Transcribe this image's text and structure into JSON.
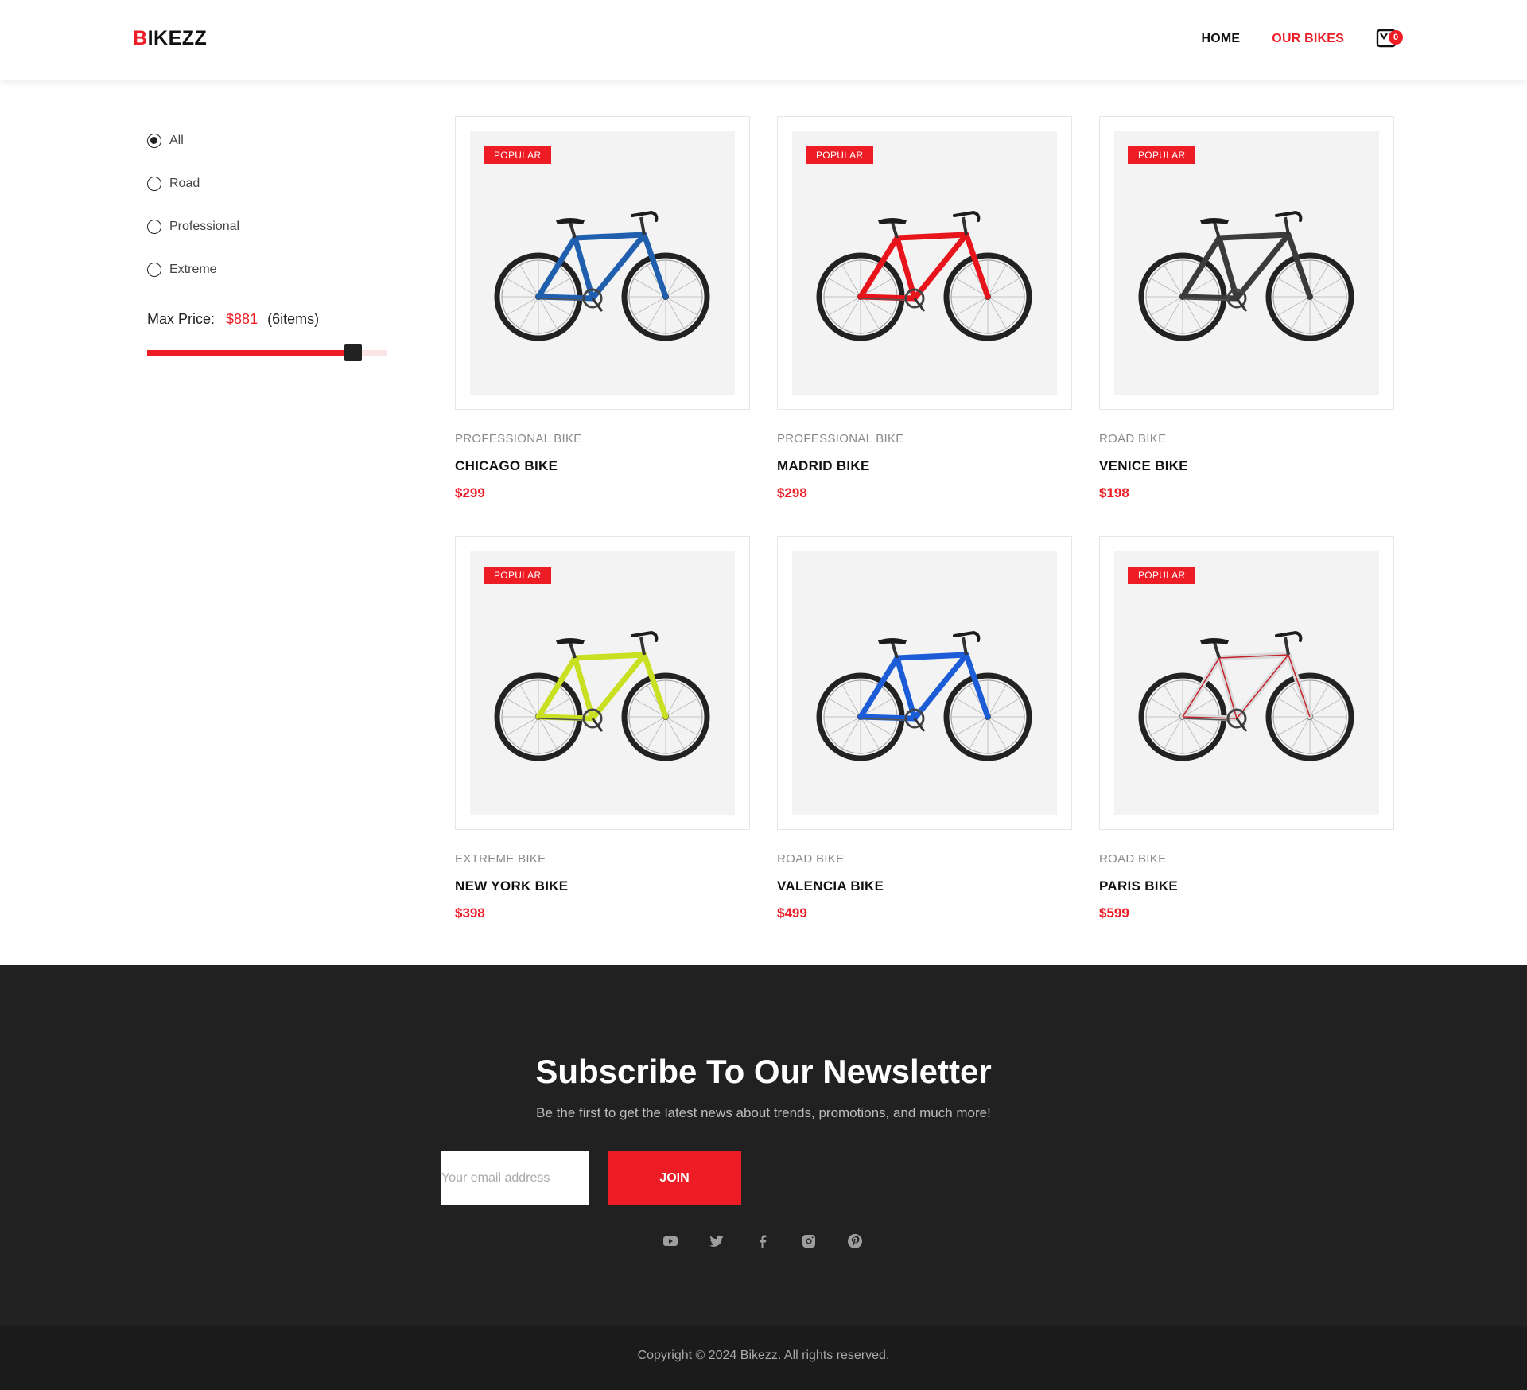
{
  "header": {
    "logo_accent": "B",
    "logo_rest": "IKEZZ",
    "nav": [
      {
        "label": "HOME",
        "active": false
      },
      {
        "label": "OUR BIKES",
        "active": true
      }
    ],
    "cart_count": "0"
  },
  "filters": {
    "options": [
      {
        "label": "All",
        "checked": true
      },
      {
        "label": "Road",
        "checked": false
      },
      {
        "label": "Professional",
        "checked": false
      },
      {
        "label": "Extreme",
        "checked": false
      }
    ],
    "max_price_label": "Max Price:",
    "max_price_value": "$881",
    "item_count": "(6items)",
    "slider_fraction": 0.86
  },
  "products": [
    {
      "badge": "POPULAR",
      "category": "PROFESSIONAL BIKE",
      "name": "CHICAGO BIKE",
      "price": "$299",
      "frame_color": "#1f5fae"
    },
    {
      "badge": "POPULAR",
      "category": "PROFESSIONAL BIKE",
      "name": "MADRID BIKE",
      "price": "$298",
      "frame_color": "#e8141c"
    },
    {
      "badge": "POPULAR",
      "category": "ROAD BIKE",
      "name": "VENICE BIKE",
      "price": "$198",
      "frame_color": "#3b3b3b"
    },
    {
      "badge": "POPULAR",
      "category": "EXTREME BIKE",
      "name": "NEW YORK BIKE",
      "price": "$398",
      "frame_color": "#c8e021"
    },
    {
      "badge": "",
      "category": "ROAD BIKE",
      "name": "VALENCIA BIKE",
      "price": "$499",
      "frame_color": "#1c5cd6"
    },
    {
      "badge": "POPULAR",
      "category": "ROAD BIKE",
      "name": "PARIS BIKE",
      "price": "$599",
      "frame_color": "#d9d9d9"
    }
  ],
  "newsletter": {
    "title": "Subscribe To Our Newsletter",
    "subtitle": "Be the first to get the latest news about trends, promotions, and much more!",
    "email_placeholder": "Your email address",
    "join_label": "JOIN",
    "social_icons": [
      "youtube-icon",
      "twitter-icon",
      "facebook-icon",
      "instagram-icon",
      "pinterest-icon"
    ]
  },
  "footer": {
    "copyright": "Copyright © 2024 Bikezz. All rights reserved."
  },
  "colors": {
    "accent": "#ee1c25",
    "dark_bg": "#212121",
    "footer_bg": "#1b1b1b"
  }
}
